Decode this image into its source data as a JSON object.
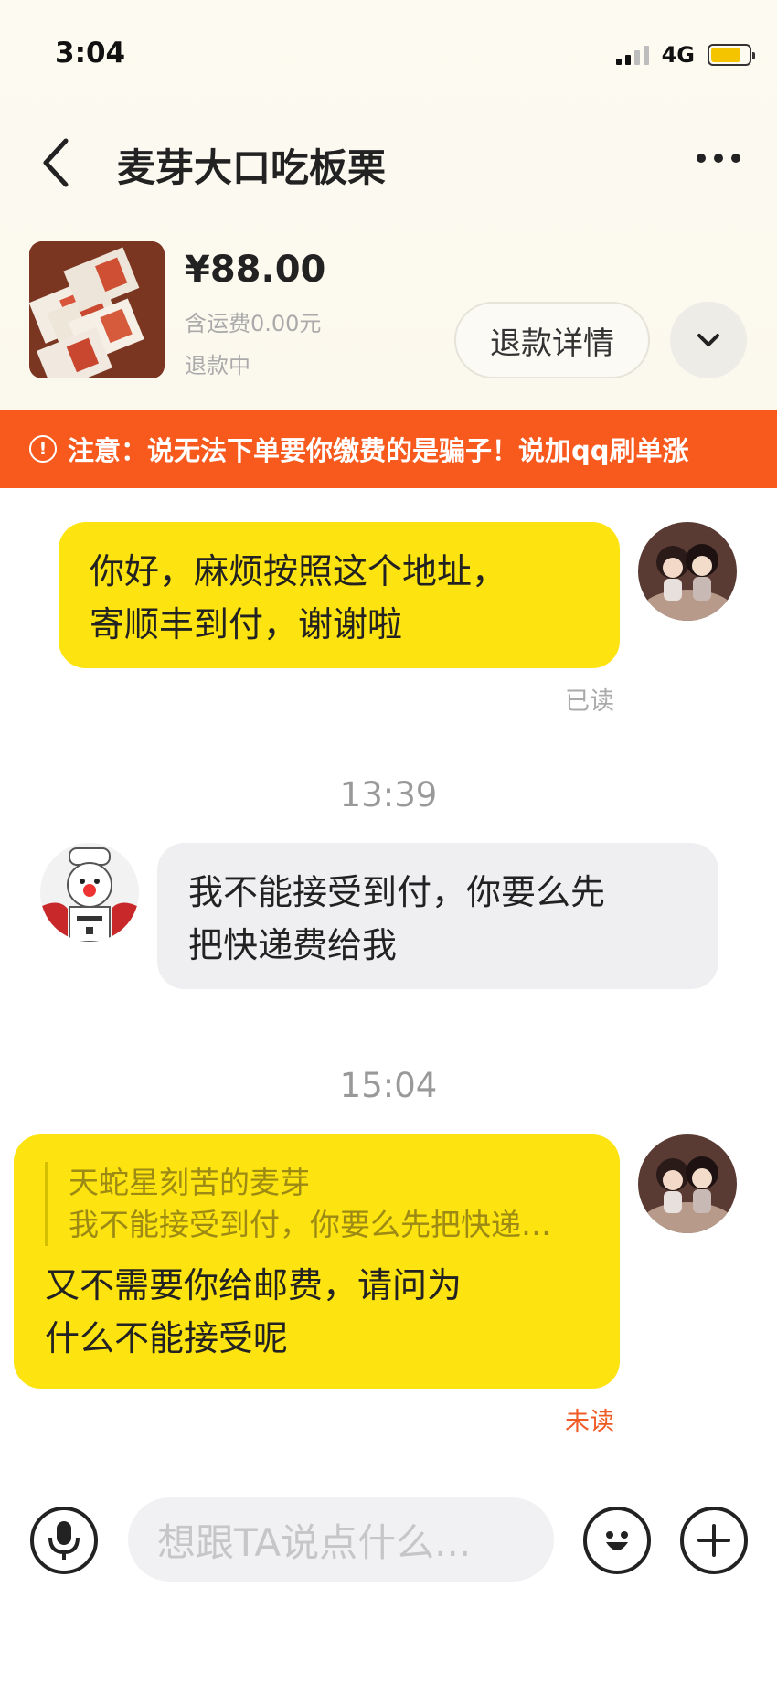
{
  "status_bar": {
    "time": "3:04",
    "network": "4G"
  },
  "nav": {
    "title": "麦芽大口吃板栗"
  },
  "product": {
    "price": "¥88.00",
    "shipping": "含运费0.00元",
    "status": "退款中",
    "refund_button": "退款详情"
  },
  "warning": {
    "icon": "!",
    "text": "注意：说无法下单要你缴费的是骗子！说加qq刷单涨"
  },
  "messages": [
    {
      "side": "right",
      "lines": [
        "你好，麻烦按照这个地址，",
        "寄顺丰到付，谢谢啦"
      ],
      "read_status": "已读"
    },
    {
      "timestamp": "13:39"
    },
    {
      "side": "left",
      "lines": [
        "我不能接受到付，你要么先",
        "把快递费给我"
      ]
    },
    {
      "timestamp": "15:04"
    },
    {
      "side": "right",
      "quote_author": "天蛇星刻苦的麦芽",
      "quote_text": "我不能接受到付，你要么先把快递…",
      "lines": [
        "又不需要你给邮费，请问为",
        "什么不能接受呢"
      ],
      "read_status": "未读"
    }
  ],
  "input": {
    "placeholder": "想跟TA说点什么..."
  },
  "colors": {
    "accent_yellow": "#fde30f",
    "warning_orange": "#f85a1e",
    "unread_red": "#f05a24"
  }
}
